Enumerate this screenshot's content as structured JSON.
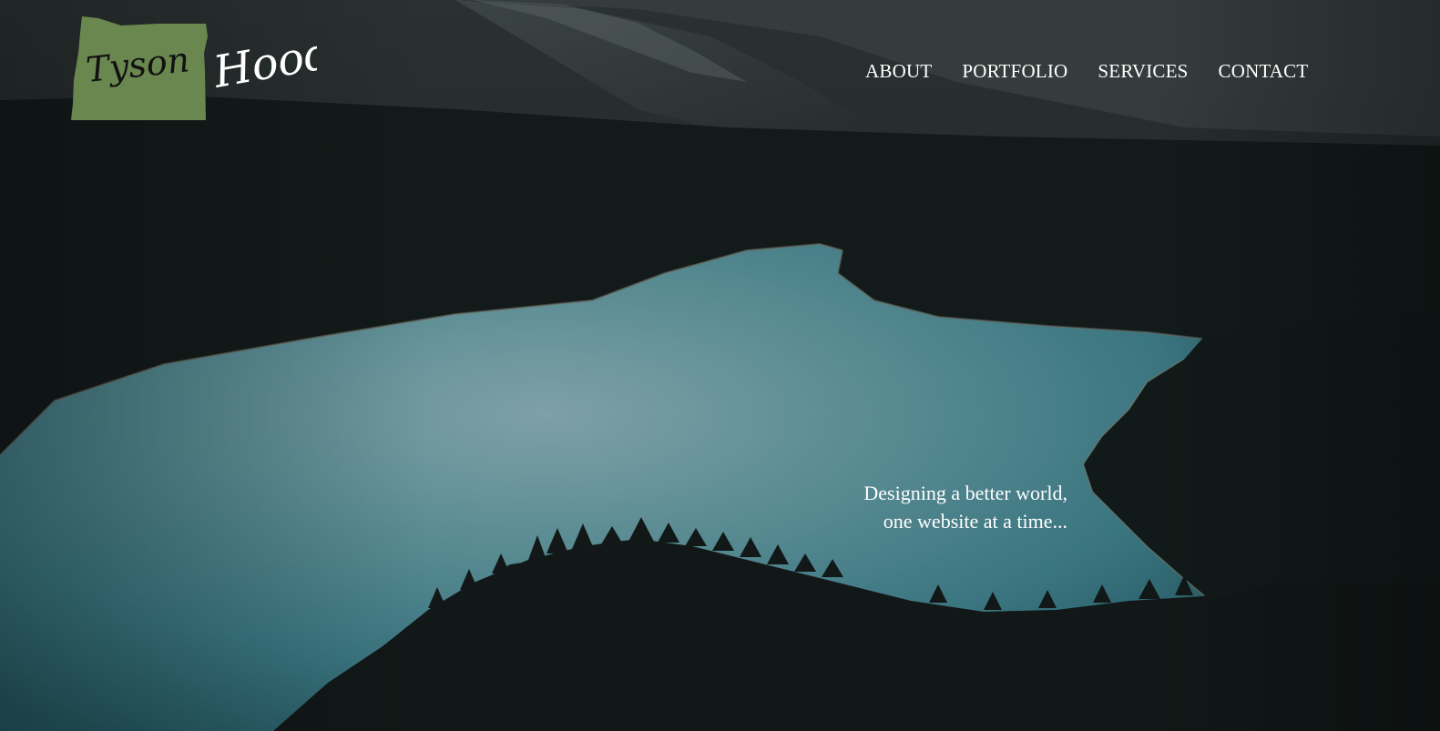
{
  "brand": {
    "first_name": "Tyson",
    "last_name": "Hood",
    "badge_color": "#6a8750"
  },
  "nav": {
    "items": [
      {
        "label": "ABOUT"
      },
      {
        "label": "PORTFOLIO"
      },
      {
        "label": "SERVICES"
      },
      {
        "label": "CONTACT"
      }
    ]
  },
  "hero": {
    "tagline_line1": "Designing a better world,",
    "tagline_line2": "one website at a time...",
    "lake_color": "#3f7f87",
    "forest_color": "#121a19"
  }
}
